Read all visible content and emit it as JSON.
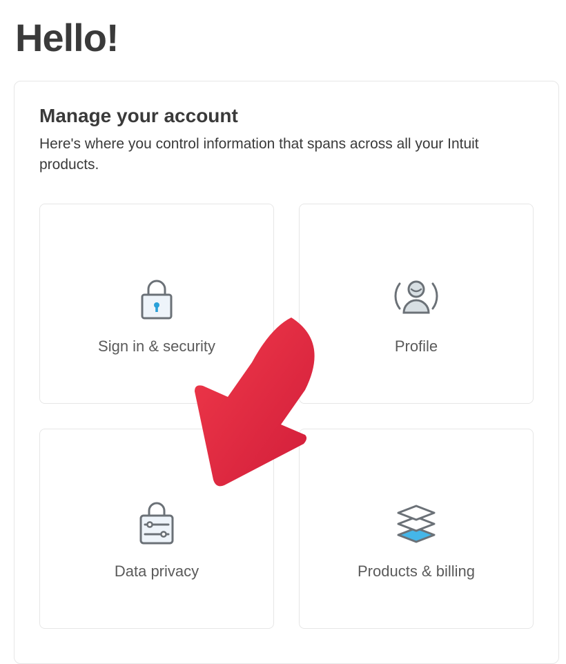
{
  "page": {
    "title": "Hello!"
  },
  "panel": {
    "title": "Manage your account",
    "subtitle": "Here's where you control information that spans across all your Intuit products."
  },
  "cards": {
    "sign_in_security": {
      "label": "Sign in & security"
    },
    "profile": {
      "label": "Profile"
    },
    "data_privacy": {
      "label": "Data privacy"
    },
    "products_billing": {
      "label": "Products & billing"
    }
  }
}
